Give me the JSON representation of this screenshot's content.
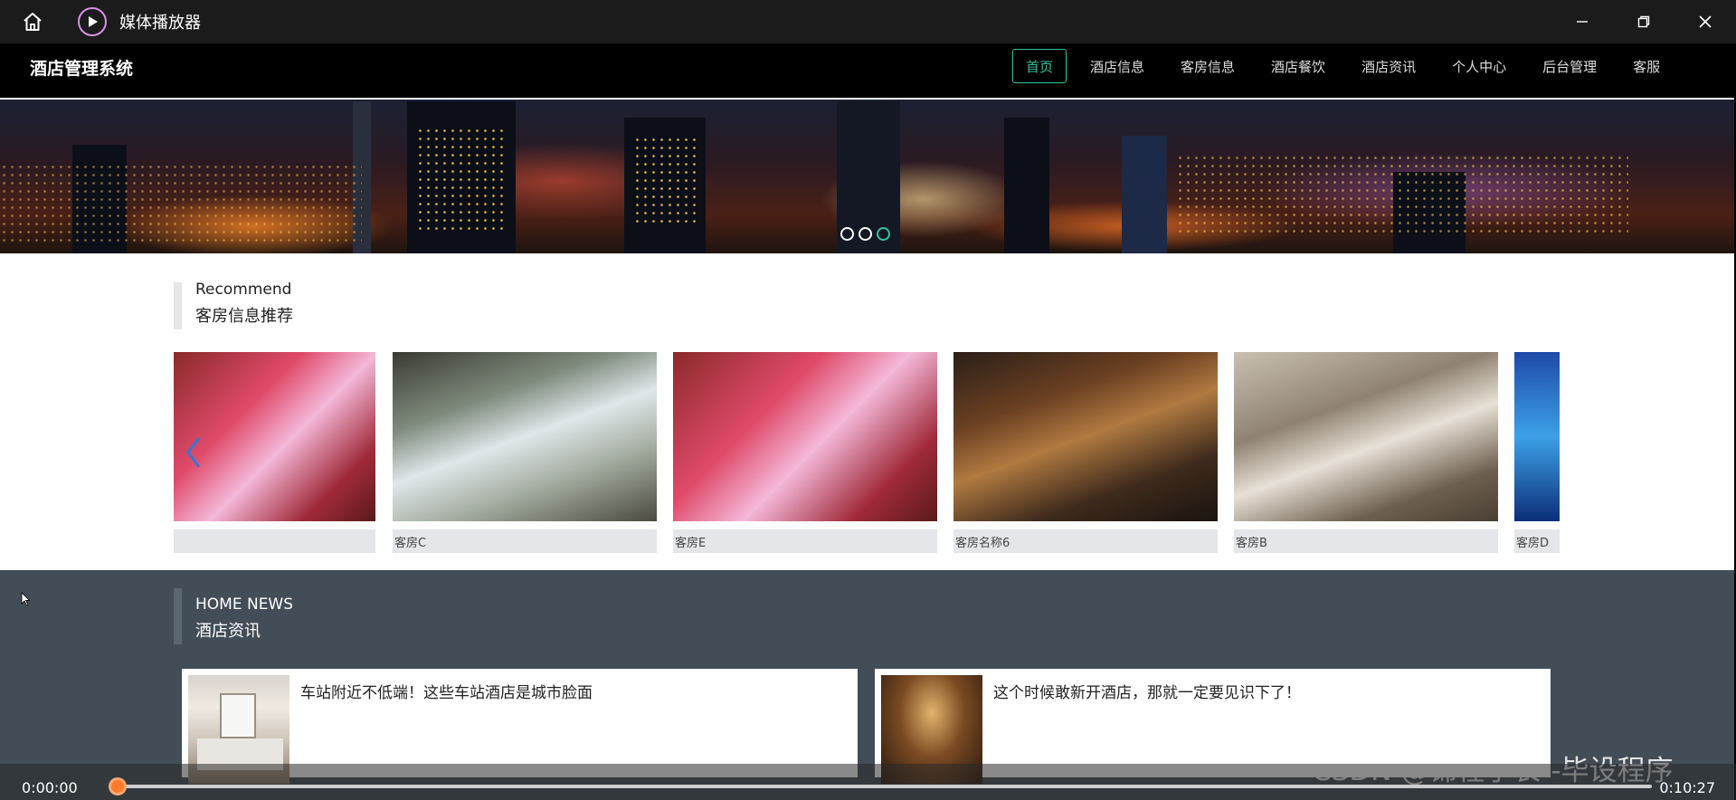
{
  "player": {
    "title": "媒体播放器",
    "current_time": "0:00:00",
    "duration": "0:10:27",
    "progress": 0.0
  },
  "site": {
    "brand": "酒店管理系统",
    "nav": [
      {
        "label": "首页",
        "active": true
      },
      {
        "label": "酒店信息",
        "active": false
      },
      {
        "label": "客房信息",
        "active": false
      },
      {
        "label": "酒店餐饮",
        "active": false
      },
      {
        "label": "酒店资讯",
        "active": false
      },
      {
        "label": "个人中心",
        "active": false
      },
      {
        "label": "后台管理",
        "active": false
      },
      {
        "label": "客服",
        "active": false
      }
    ],
    "banner": {
      "slide_count": 3,
      "active_slide": 3
    },
    "recommend": {
      "title_en": "Recommend",
      "title_zh": "客房信息推荐",
      "rooms": [
        {
          "name": ""
        },
        {
          "name": "客房C"
        },
        {
          "name": "客房E"
        },
        {
          "name": "客房名称6"
        },
        {
          "name": "客房B"
        },
        {
          "name": "客房D"
        }
      ]
    },
    "news": {
      "title_en": "HOME NEWS",
      "title_zh": "酒店资讯",
      "items": [
        {
          "title": "车站附近不低端！这些车站酒店是城市脸面"
        },
        {
          "title": "这个时候敢新开酒店，那就一定要见识下了！"
        }
      ]
    }
  },
  "watermark": "CSDN @锦程学长--毕设程序",
  "colors": {
    "accent": "#38c1a0",
    "seek_knob": "#ff7a2a",
    "news_bg": "#424d57"
  }
}
